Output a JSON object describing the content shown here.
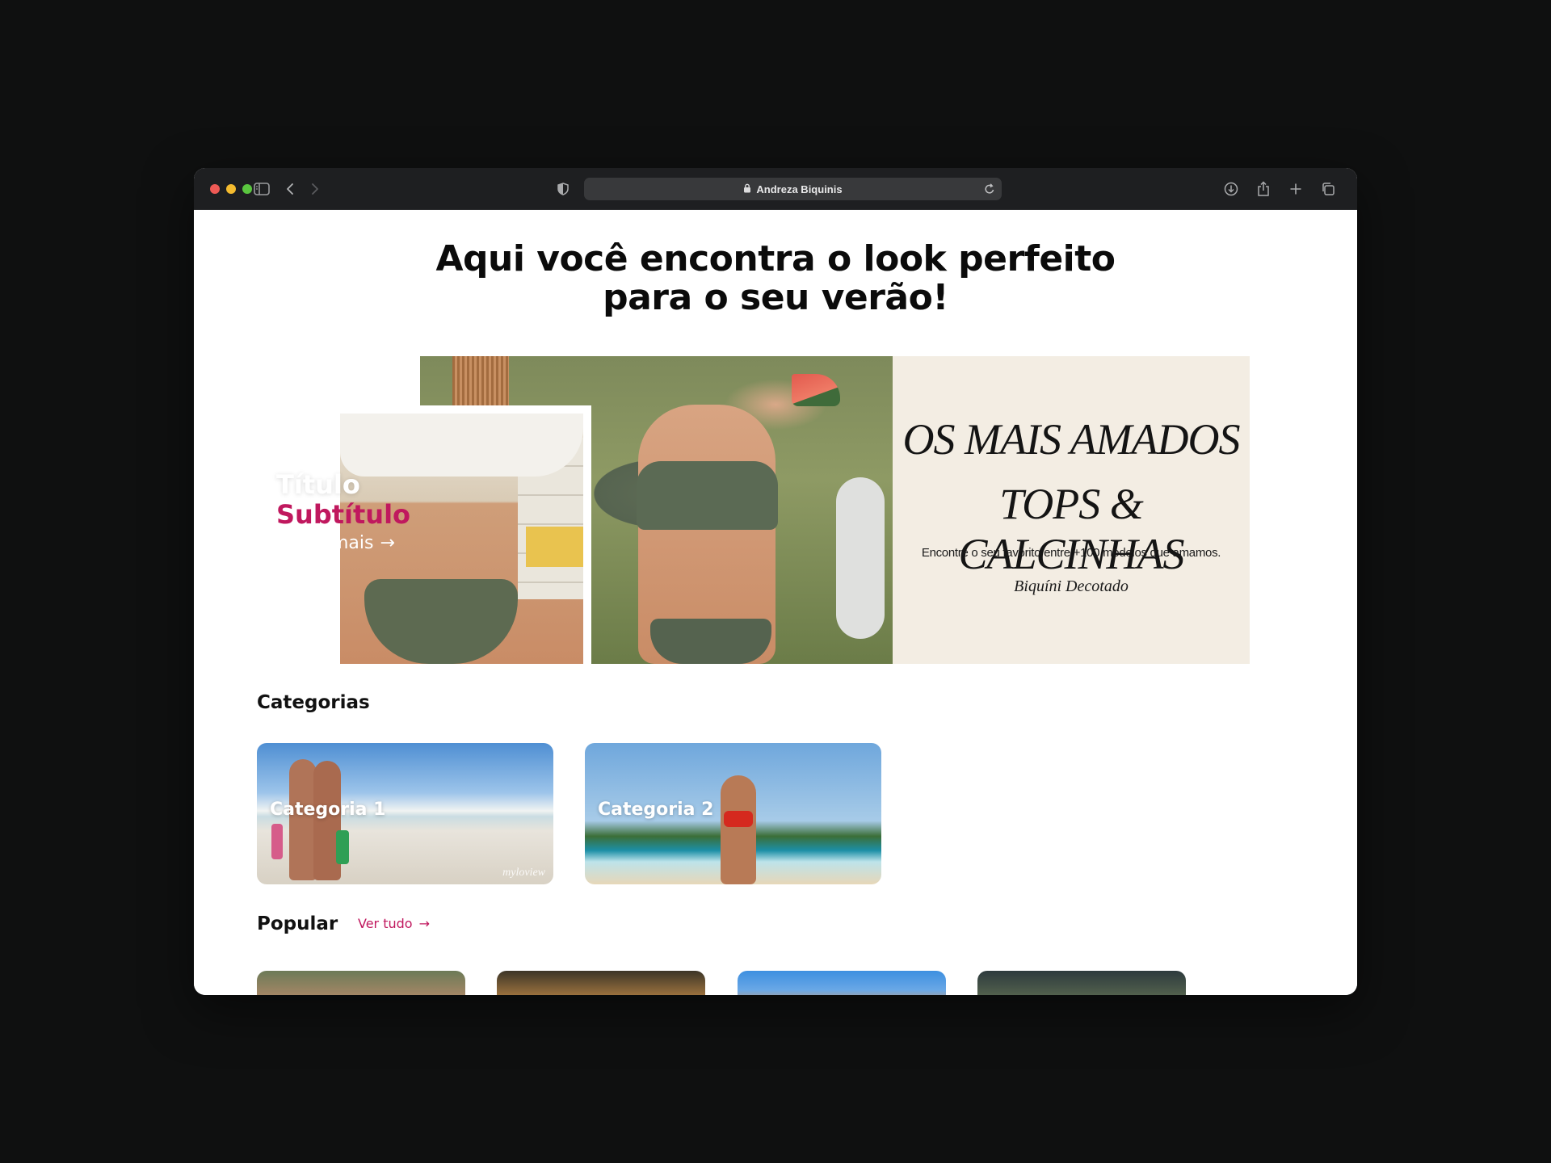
{
  "browser": {
    "url_title": "Andreza Biquinis"
  },
  "page": {
    "headline_line1": "Aqui você encontra o look perfeito",
    "headline_line2": "para o seu verão!",
    "hero": {
      "promo_line1": "OS MAIS AMADOS",
      "promo_line2": "TOPS & CALCINHAS",
      "promo_subtitle": "Encontre o seu favorito entre +100 modelos que amamos.",
      "promo_product": "Biquíni Decotado",
      "caption_title": "Título",
      "caption_subtitle": "Subtítulo",
      "caption_link": "Saiba mais",
      "caption_link_arrow": "→"
    },
    "categories": {
      "title": "Categorias",
      "items": [
        {
          "label": "Categoria 1",
          "watermark": "myloview"
        },
        {
          "label": "Categoria 2"
        }
      ]
    },
    "popular": {
      "title": "Popular",
      "view_all": "Ver tudo",
      "view_all_arrow": "→"
    }
  },
  "colors": {
    "accent": "#c0185e",
    "toolbar": "#1e1f21",
    "background": "#0f1010",
    "promo_bg": "#f3ede3"
  }
}
